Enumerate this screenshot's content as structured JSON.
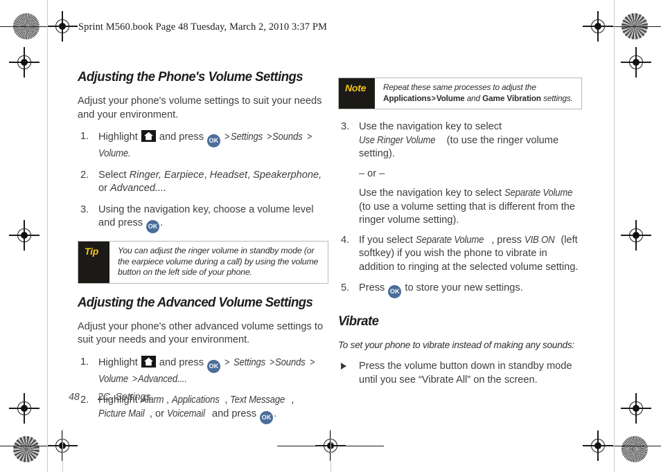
{
  "page": {
    "book_header": "Sprint M560.book  Page 48  Tuesday, March 2, 2010  3:37 PM",
    "footer_page_number": "48",
    "footer_chapter": "2C. Settings",
    "accent_yellow": "#f4c518",
    "callout_label_bg": "#1c1a17",
    "ok_button_color": "#4a6d99",
    "home_icon_bg": "#161616"
  },
  "left_column": {
    "section1": {
      "title": "Adjusting the Phone's Volume Settings",
      "intro": "Adjust your phone's volume settings to suit your needs and your environment.",
      "steps": [
        {
          "num": "1.",
          "parts": [
            {
              "type": "text",
              "value": "Highlight "
            },
            {
              "type": "icon",
              "value": "home-icon"
            },
            {
              "type": "text",
              "value": " and press "
            },
            {
              "type": "icon",
              "value": "ok-icon"
            },
            {
              "type": "text",
              "value": " "
            },
            {
              "type": "gt",
              "value": ">"
            },
            {
              "type": "italic",
              "value": "Settings"
            },
            {
              "type": "gt",
              "value": ">"
            },
            {
              "type": "italic",
              "value": "Sounds"
            },
            {
              "type": "gt",
              "value": ">"
            },
            {
              "type": "italic",
              "value": "Volume."
            }
          ]
        },
        {
          "num": "2.",
          "parts": [
            {
              "type": "text",
              "value": "Select "
            },
            {
              "type": "italic",
              "value": "Ringer,"
            },
            {
              "type": "text",
              "value": " "
            },
            {
              "type": "italic",
              "value": "Earpiece"
            },
            {
              "type": "text",
              "value": ", "
            },
            {
              "type": "italic",
              "value": "Headset"
            },
            {
              "type": "text",
              "value": ", "
            },
            {
              "type": "italic",
              "value": "Speakerphone,"
            },
            {
              "type": "text",
              "value": " or "
            },
            {
              "type": "italic",
              "value": "Advanced...."
            }
          ]
        },
        {
          "num": "3.",
          "parts": [
            {
              "type": "text",
              "value": "Using the navigation key, choose a volume level and press "
            },
            {
              "type": "icon",
              "value": "ok-icon"
            },
            {
              "type": "text",
              "value": "."
            }
          ]
        }
      ],
      "tip_box": {
        "label": "Tip",
        "text": "You can adjust the ringer volume in standby mode (or the earpiece volume during a call) by using the volume button on the left side of your phone."
      }
    },
    "section2": {
      "title": "Adjusting the Advanced Volume Settings",
      "intro": "Adjust your phone's other advanced volume settings to suit your needs and your environment.",
      "steps": [
        {
          "num": "1.",
          "parts": [
            {
              "type": "text",
              "value": "Highlight "
            },
            {
              "type": "icon",
              "value": "home-icon"
            },
            {
              "type": "text",
              "value": " and press "
            },
            {
              "type": "icon",
              "value": "ok-icon"
            },
            {
              "type": "text",
              "value": " "
            },
            {
              "type": "gt",
              "value": ">"
            },
            {
              "type": "italic",
              "value": " Settings"
            },
            {
              "type": "gt",
              "value": ">"
            },
            {
              "type": "italic",
              "value": "Sounds"
            },
            {
              "type": "gt",
              "value": ">"
            },
            {
              "type": "italic",
              "value": "Volume"
            },
            {
              "type": "gt",
              "value": ">"
            },
            {
              "type": "italic",
              "value": "Advanced...."
            }
          ]
        },
        {
          "num": "2.",
          "parts": [
            {
              "type": "text",
              "value": "Highlight "
            },
            {
              "type": "italic",
              "value": "Alarm"
            },
            {
              "type": "text",
              "value": ", "
            },
            {
              "type": "italic",
              "value": "Applications"
            },
            {
              "type": "text",
              "value": ", "
            },
            {
              "type": "italic",
              "value": "Text Message"
            },
            {
              "type": "text",
              "value": ", "
            },
            {
              "type": "italic",
              "value": "Picture Mail"
            },
            {
              "type": "text",
              "value": ", or "
            },
            {
              "type": "italic",
              "value": "Voicemail"
            },
            {
              "type": "text",
              "value": " and press "
            },
            {
              "type": "icon",
              "value": "ok-icon"
            },
            {
              "type": "text",
              "value": "."
            }
          ]
        }
      ]
    }
  },
  "right_column": {
    "note_box": {
      "label": "Note",
      "line1": "Repeat these same processes to adjust the",
      "line2_parts": [
        {
          "type": "bold",
          "value": "Applications"
        },
        {
          "type": "gt",
          "value": ">"
        },
        {
          "type": "bold",
          "value": "Volume"
        },
        {
          "type": "italic",
          "value": " and "
        },
        {
          "type": "bold",
          "value": "Game Vibration"
        },
        {
          "type": "italic",
          "value": " settings."
        }
      ]
    },
    "steps": [
      {
        "num": "3.",
        "parts": [
          {
            "type": "text",
            "value": "Use the navigation key to select "
          },
          {
            "type": "italic",
            "value": "Use Ringer Volume"
          },
          {
            "type": "text",
            "value": " (to use the ringer volume setting)."
          }
        ],
        "sub_or": "– or –",
        "sub_text": "Use the navigation key to select ",
        "sub_italic": "Separate Volume",
        "sub_tail": " (to use a volume setting that is different from the ringer volume setting)."
      },
      {
        "num": "4.",
        "parts": [
          {
            "type": "text",
            "value": "If you select "
          },
          {
            "type": "italic",
            "value": "Separate Volume"
          },
          {
            "type": "text",
            "value": ", press "
          },
          {
            "type": "italic",
            "value": "VIB ON"
          },
          {
            "type": "text",
            "value": " (left softkey) if you wish the phone to vibrate in addition to ringing at the selected volume setting."
          }
        ]
      },
      {
        "num": "5.",
        "parts": [
          {
            "type": "text",
            "value": "Press "
          },
          {
            "type": "icon",
            "value": "ok-icon"
          },
          {
            "type": "text",
            "value": " to store your new settings."
          }
        ]
      }
    ],
    "section_vibrate": {
      "title": "Vibrate",
      "intro": "To set your phone to vibrate instead of making any sounds:",
      "bullet": "Press the volume button down in standby mode until you see “Vibrate All” on the screen."
    }
  }
}
